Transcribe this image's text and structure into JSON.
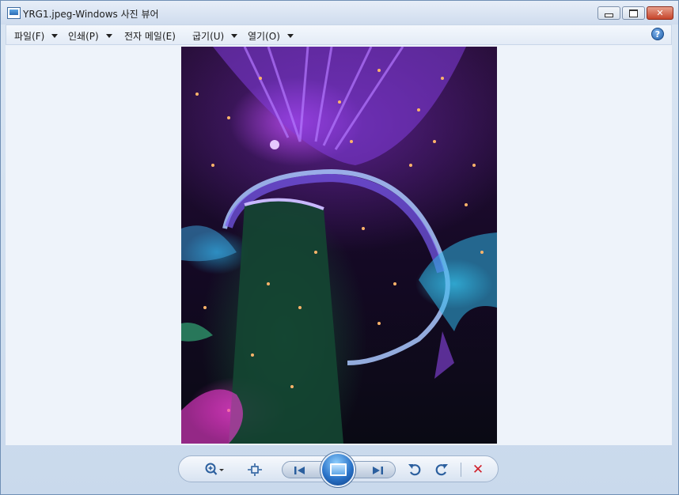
{
  "window": {
    "title": "YRG1.jpeg-Windows 사진 뷰어",
    "minimize_icon": "minimize-icon",
    "maximize_icon": "maximize-icon",
    "close_glyph": "✕"
  },
  "menu": {
    "file": "파일(F)",
    "print": "인쇄(P)",
    "email": "전자 메일(E)",
    "burn": "굽기(U)",
    "open": "열기(O)",
    "help_glyph": "?"
  },
  "image": {
    "description_icon": "photo-supertree-grove-night"
  },
  "toolbar": {
    "zoom_icon": "zoom-icon",
    "actual_size_icon": "actual-size-icon",
    "previous_icon": "previous-icon",
    "slideshow_icon": "slideshow-icon",
    "next_icon": "next-icon",
    "rotate_ccw_icon": "rotate-ccw-icon",
    "rotate_cw_icon": "rotate-cw-icon",
    "delete_glyph": "✕"
  },
  "colors": {
    "accent": "#2b5f9e",
    "delete": "#d0202a",
    "close_button": "#c6452b"
  }
}
